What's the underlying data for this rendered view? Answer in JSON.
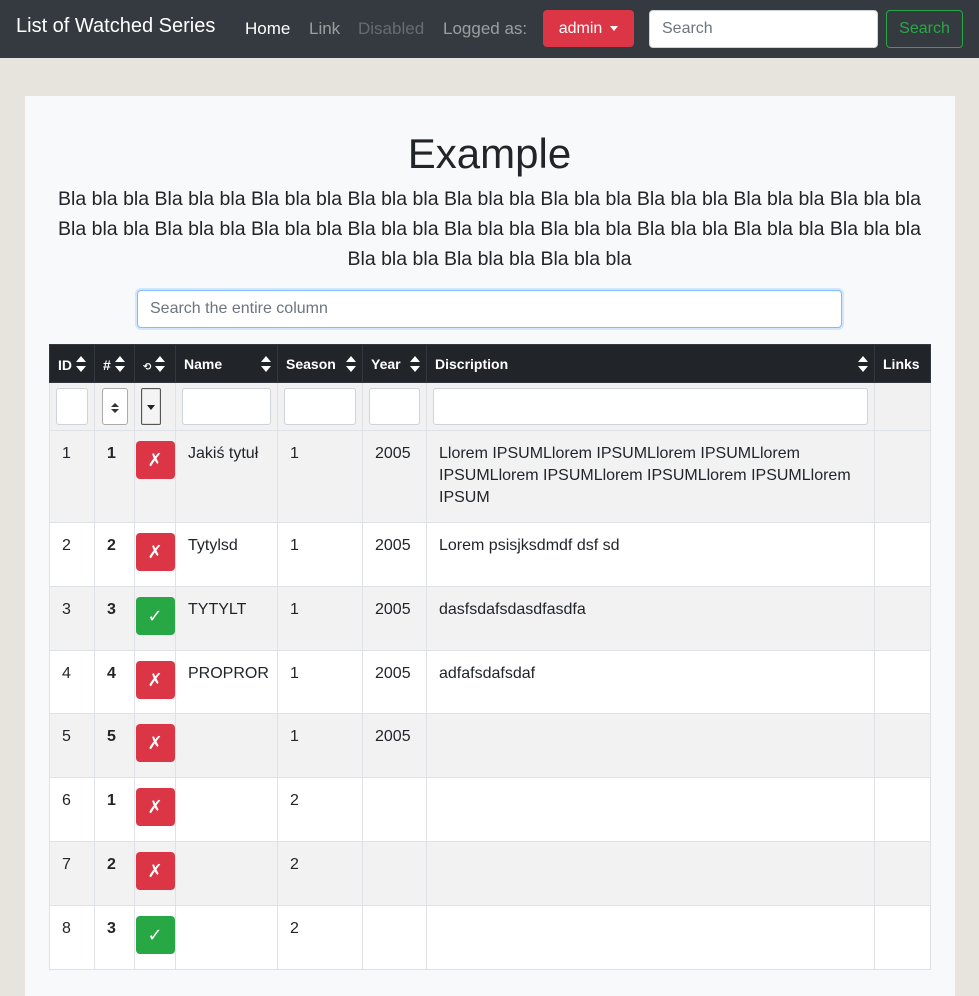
{
  "navbar": {
    "brand": "List of Watched Series",
    "links": [
      "Home",
      "Link",
      "Disabled"
    ],
    "logged_as": "Logged as:",
    "user_button": "admin",
    "search_placeholder": "Search",
    "search_button": "Search"
  },
  "page": {
    "title": "Example",
    "lead": "Bla bla bla Bla bla bla Bla bla bla Bla bla bla Bla bla bla Bla bla bla Bla bla bla Bla bla bla Bla bla bla Bla bla bla Bla bla bla Bla bla bla Bla bla bla Bla bla bla Bla bla bla Bla bla bla Bla bla bla Bla bla bla Bla bla bla Bla bla bla Bla bla bla",
    "column_search_placeholder": "Search the entire column"
  },
  "table": {
    "headers": [
      "ID",
      "#",
      "⟲",
      "Name",
      "Season",
      "Year",
      "Discription",
      "Links"
    ],
    "rows": [
      {
        "id": "1",
        "num": "1",
        "watched": false,
        "name": "Jakiś tytuł",
        "season": "1",
        "year": "2005",
        "description": "Llorem IPSUMLlorem IPSUMLlorem IPSUMLlorem IPSUMLlorem IPSUMLlorem IPSUMLlorem IPSUMLlorem IPSUM"
      },
      {
        "id": "2",
        "num": "2",
        "watched": false,
        "name": "Tytylsd",
        "season": "1",
        "year": "2005",
        "description": "Lorem psisjksdmdf dsf sd"
      },
      {
        "id": "3",
        "num": "3",
        "watched": true,
        "name": "TYTYLT",
        "season": "1",
        "year": "2005",
        "description": "dasfsdafsdasdfasdfa"
      },
      {
        "id": "4",
        "num": "4",
        "watched": false,
        "name": "PROPROR",
        "season": "1",
        "year": "2005",
        "description": "adfafsdafsdaf"
      },
      {
        "id": "5",
        "num": "5",
        "watched": false,
        "name": "",
        "season": "1",
        "year": "2005",
        "description": ""
      },
      {
        "id": "6",
        "num": "1",
        "watched": false,
        "name": "",
        "season": "2",
        "year": "",
        "description": ""
      },
      {
        "id": "7",
        "num": "2",
        "watched": false,
        "name": "",
        "season": "2",
        "year": "",
        "description": ""
      },
      {
        "id": "8",
        "num": "3",
        "watched": true,
        "name": "",
        "season": "2",
        "year": "",
        "description": ""
      }
    ],
    "status_symbols": {
      "no": "✗",
      "yes": "✓"
    },
    "status_colors": {
      "no": "#dc3545",
      "yes": "#28a745"
    }
  }
}
